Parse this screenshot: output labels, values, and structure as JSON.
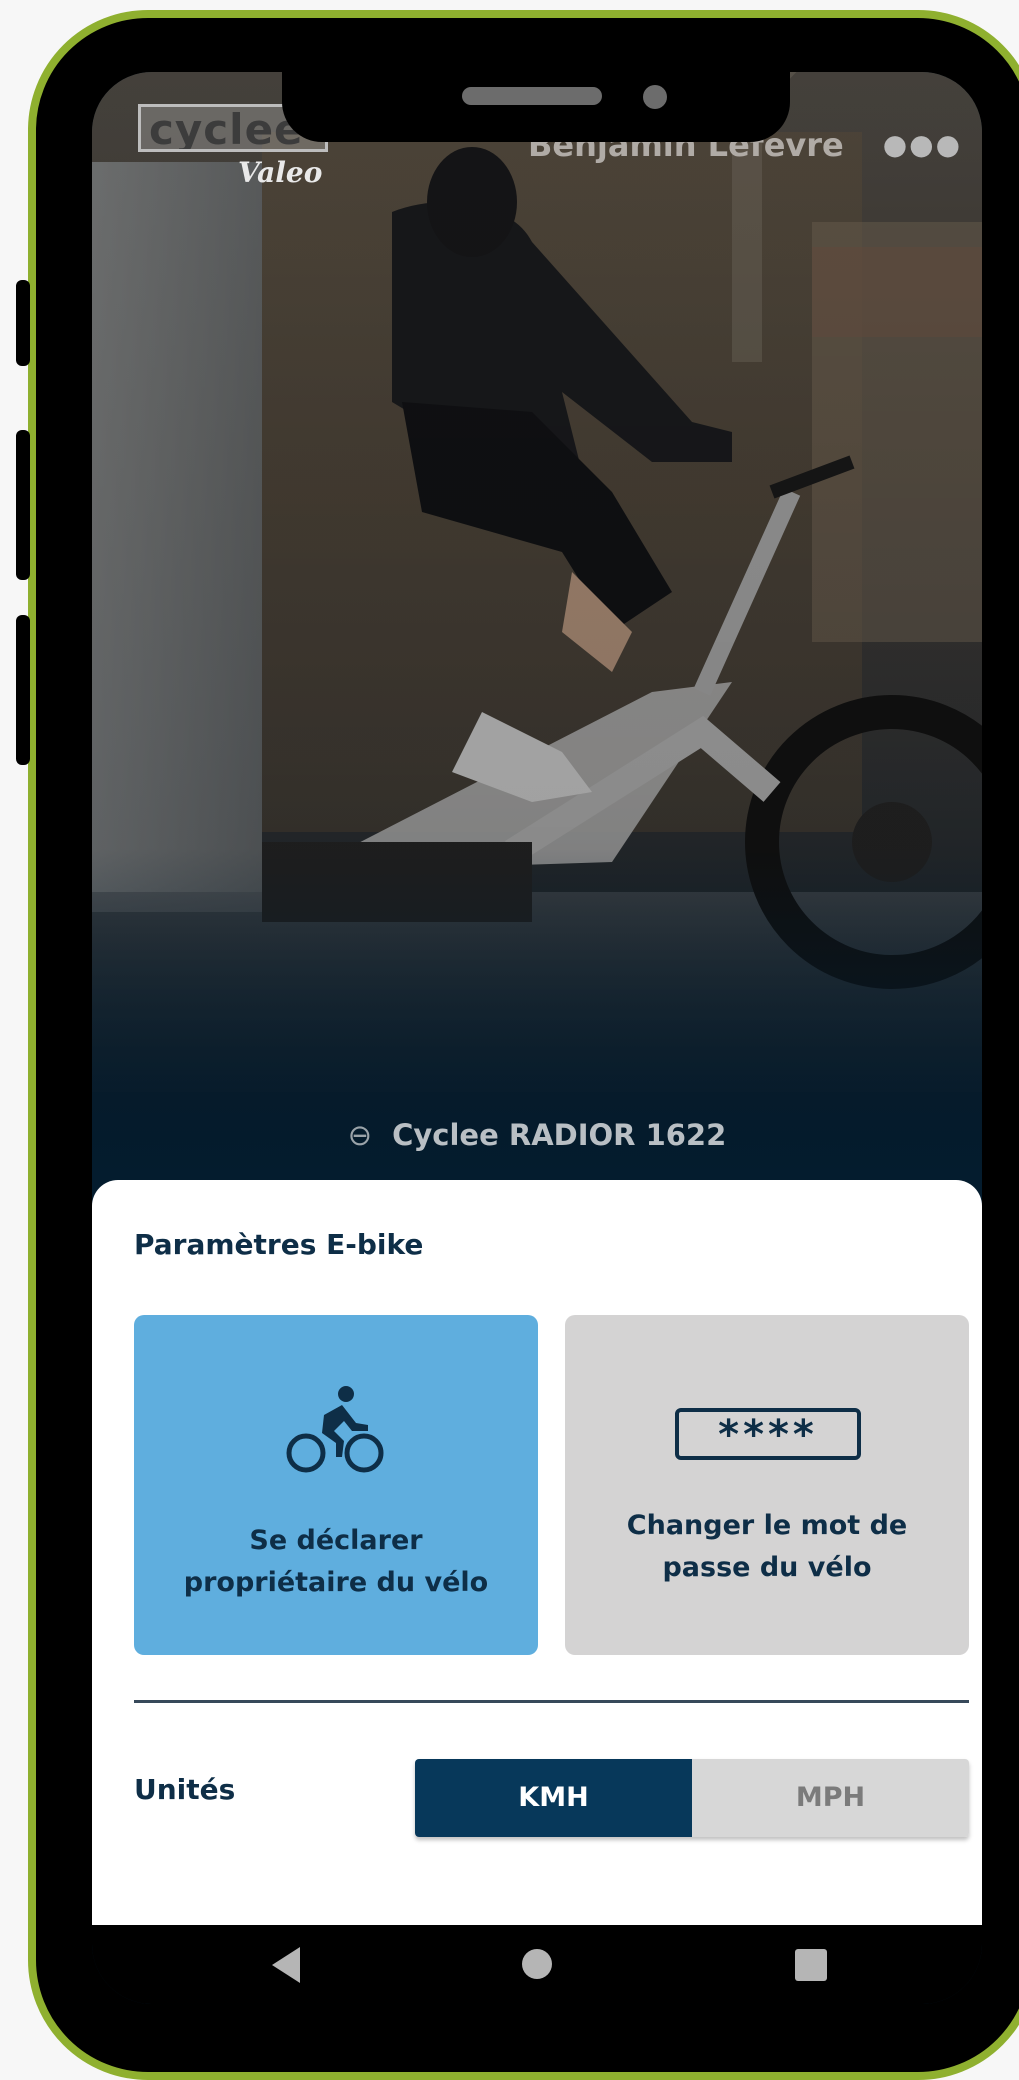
{
  "header": {
    "logo_text": "cyclee",
    "logo_sub": "Valeo",
    "user_name": "Benjamin Lefevre",
    "menu_icon": "more-dots-icon"
  },
  "bike": {
    "link_icon": "⊖",
    "name": "Cyclee RADIOR 1622"
  },
  "settings": {
    "title": "Paramètres E-bike",
    "owner_card": {
      "label_line1": "Se déclarer",
      "label_line2": "propriétaire du vélo",
      "icon": "cyclist-icon",
      "color": "#5faede"
    },
    "password_card": {
      "label_line1": "Changer le mot de",
      "label_line2": "passe du vélo",
      "icon_text": "****",
      "color": "#d4d3d3"
    },
    "units": {
      "label": "Unités",
      "options": [
        "KMH",
        "MPH"
      ],
      "selected": "KMH"
    }
  },
  "colors": {
    "accent": "#07385a",
    "frame": "#8fb02f",
    "text_dark": "#0e2e47"
  }
}
